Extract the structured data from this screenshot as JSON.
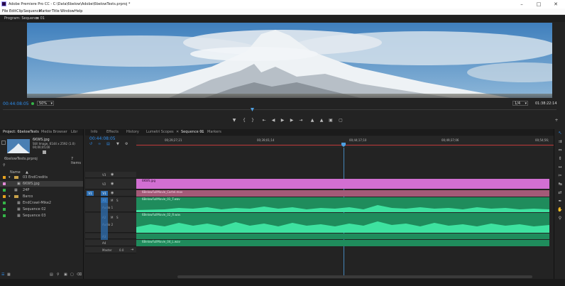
{
  "window": {
    "title": "Adobe Premiere Pro CC - C:\\Data\\6below\\Adobe\\6belowTests.prproj *"
  },
  "menu": [
    "File",
    "Edit",
    "Clip",
    "Sequence",
    "Marker",
    "Title",
    "Window",
    "Help"
  ],
  "program_monitor": {
    "tab_label": "Program: Sequence 01",
    "tab_menu": "≡",
    "timecode": "00:44:08:05",
    "zoom": "50%",
    "resolution": "1/4",
    "duration": "01:38:22:14"
  },
  "project_panel": {
    "tabs": [
      "Project: 6belowTests",
      "Media Browser",
      "Libr"
    ],
    "clip_name": "6KWS.jpg",
    "clip_info": "Still Image, 6144 x 2592 (1.0)",
    "clip_time": "00;00;05;00",
    "project_file": "6belowTests.prproj",
    "item_count": "7 Items",
    "column_header": "Name",
    "items": [
      {
        "label": "03 EndCredits",
        "color": "#e8a21e",
        "indent": 0
      },
      {
        "label": "6KWS.jpg",
        "color": "#e28ad6",
        "indent": 1
      },
      {
        "label": "24P",
        "color": "#35b548",
        "indent": 0
      },
      {
        "label": "Barco",
        "color": "#e8a21e",
        "indent": 0
      },
      {
        "label": "EndCrawl-Mike2",
        "color": "#35b548",
        "indent": 1
      },
      {
        "label": "Sequence 02",
        "color": "#35b548",
        "indent": 1
      },
      {
        "label": "Sequence 03",
        "color": "#35b548",
        "indent": 1
      }
    ]
  },
  "timeline": {
    "tabs": [
      "Info",
      "Effects",
      "History",
      "Lumetri Scopes",
      "Sequence 01",
      "Markers"
    ],
    "active_tab": "Sequence 01",
    "timecode": "00:44:08:05",
    "ruler_labels": [
      "00;29;27;21",
      "00;39;01;14",
      "00;44;17;10",
      "00;49;37;06",
      "00;54;56;"
    ],
    "tracks": {
      "v3": "V3",
      "v2": "V2",
      "v1": "V1",
      "a1": "A1",
      "audio1": "Audio 1",
      "a2": "A2",
      "audio2": "Audio 2",
      "a3": "A3",
      "a4": "A4",
      "master": "Master",
      "master_val": "0.0",
      "src_v1": "V1",
      "src_a1": "A1"
    },
    "clips": {
      "v2": "6KWS.jpg",
      "v1": "6BelowFullMovie_Cartel.mov",
      "a1": "6BelowFullMovie_01_T.wav",
      "a2": "6BelowFullMovie_02_R.wav",
      "a4": "6BelowFullMovie_04_L.wav"
    }
  },
  "colors": {
    "accent_blue": "#2d8ceb",
    "clip_pink": "#d26fd2",
    "clip_dark_pink": "#a45a78",
    "audio_green": "#1f8c5c",
    "wave_green": "#3ee2a0",
    "playhead": "#4e9fe0"
  }
}
